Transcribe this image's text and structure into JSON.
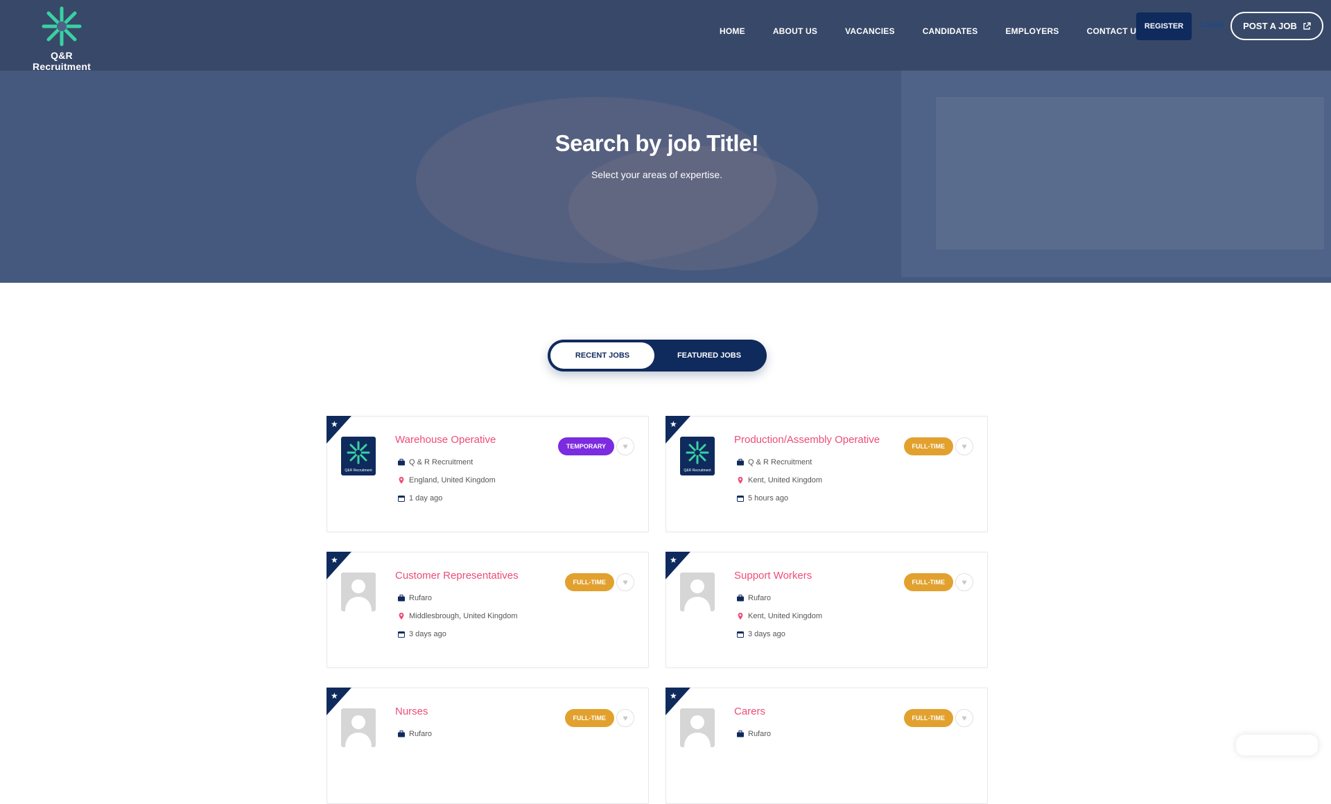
{
  "brand": {
    "name": "Q&R Recruitment",
    "accent": "#39d1a3",
    "navy": "#0f2a5c",
    "pink": "#ef4b78"
  },
  "nav": {
    "items": [
      "HOME",
      "ABOUT US",
      "VACANCIES",
      "CANDIDATES",
      "EMPLOYERS",
      "CONTACT US"
    ],
    "register": "REGISTER",
    "login": "LOGIN",
    "post_job": "POST A JOB"
  },
  "hero": {
    "title": "Search by job Title!",
    "subtitle": "Select your areas of expertise."
  },
  "tabs": {
    "recent": "RECENT JOBS",
    "featured": "FEATURED JOBS",
    "active": "recent"
  },
  "jobs": [
    {
      "title": "Warehouse Operative",
      "company": "Q & R Recruitment",
      "location": "England, United Kingdom",
      "posted": "1 day ago",
      "type": "TEMPORARY",
      "logo": "brand-icon",
      "logo_text": "Q&R Recruitment"
    },
    {
      "title": "Production/Assembly Operative",
      "company": "Q & R Recruitment",
      "location": "Kent, United Kingdom",
      "posted": "5 hours ago",
      "type": "FULL-TIME",
      "logo": "brand-icon",
      "logo_text": "Q&R Recruitment"
    },
    {
      "title": "Customer Representatives",
      "company": "Rufaro",
      "location": "Middlesbrough, United Kingdom",
      "posted": "3 days ago",
      "type": "FULL-TIME",
      "logo": "person-icon"
    },
    {
      "title": "Support Workers",
      "company": "Rufaro",
      "location": "Kent, United Kingdom",
      "posted": "3 days ago",
      "type": "FULL-TIME",
      "logo": "person-icon"
    },
    {
      "title": "Nurses",
      "company": "Rufaro",
      "location": "",
      "posted": "",
      "type": "FULL-TIME",
      "logo": "person-icon"
    },
    {
      "title": "Carers",
      "company": "Rufaro",
      "location": "",
      "posted": "",
      "type": "FULL-TIME",
      "logo": "person-icon"
    }
  ]
}
